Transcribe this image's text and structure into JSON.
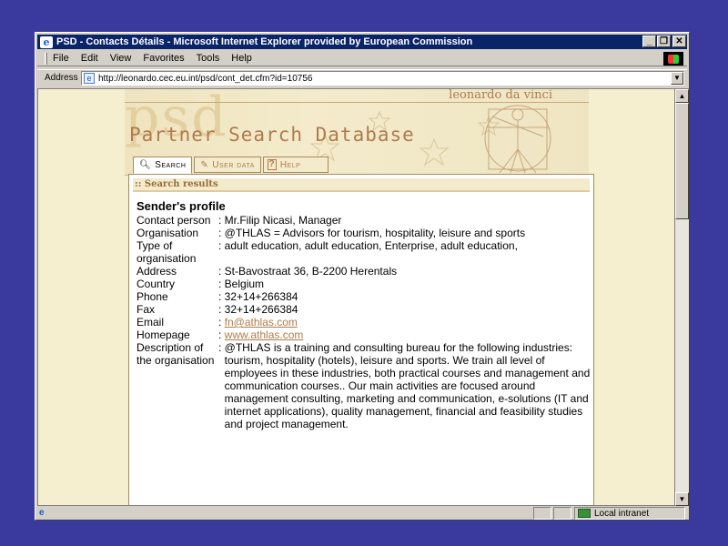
{
  "window": {
    "title": "PSD - Contacts Détails - Microsoft Internet Explorer provided by European Commission",
    "controls": {
      "minimize": "_",
      "restore": "❐",
      "close": "✕"
    }
  },
  "menubar": {
    "items": [
      {
        "label": "File"
      },
      {
        "label": "Edit"
      },
      {
        "label": "View"
      },
      {
        "label": "Favorites"
      },
      {
        "label": "Tools"
      },
      {
        "label": "Help"
      }
    ]
  },
  "address": {
    "label": "Address",
    "url": "http://leonardo.cec.eu.int/psd/cont_det.cfm?id=10756"
  },
  "banner": {
    "logo": "psd",
    "title": "Partner Search Database",
    "leonardo": "leonardo da vinci"
  },
  "tabs": [
    {
      "label": "Search",
      "icon": "magnifier-icon"
    },
    {
      "label": "User data",
      "icon": "pencil-icon"
    },
    {
      "label": "Help",
      "icon": "question-icon"
    }
  ],
  "panel": {
    "heading": ":: Search results"
  },
  "profile": {
    "heading": "Sender's profile",
    "fields": {
      "contact_label": "Contact person",
      "contact": "Mr.Filip Nicasi, Manager",
      "organisation_label": "Organisation",
      "organisation": "@THLAS = Advisors for tourism, hospitality, leisure and sports",
      "type_label": "Type of organisation",
      "type": "adult education, adult education, Enterprise, adult education,",
      "address_label": "Address",
      "address": "St-Bavostraat 36, B-2200 Herentals",
      "country_label": "Country",
      "country": "Belgium",
      "phone_label": "Phone",
      "phone": "32+14+266384",
      "fax_label": "Fax",
      "fax": "32+14+266384",
      "email_label": "Email",
      "email": "fn@athlas.com",
      "homepage_label": "Homepage",
      "homepage": "www.athlas.com",
      "description_label": "Description of the organisation",
      "description": "@THLAS is a training and consulting bureau for the following industries: tourism, hospitality (hotels), leisure and sports. We train all level of employees in these industries, both practical courses and management and communication courses.. Our main activities are focused around management consulting, marketing and communication, e-solutions (IT and internet applications), quality management, financial and feasibility studies and project management."
    }
  },
  "status": {
    "zone": "Local intranet"
  }
}
